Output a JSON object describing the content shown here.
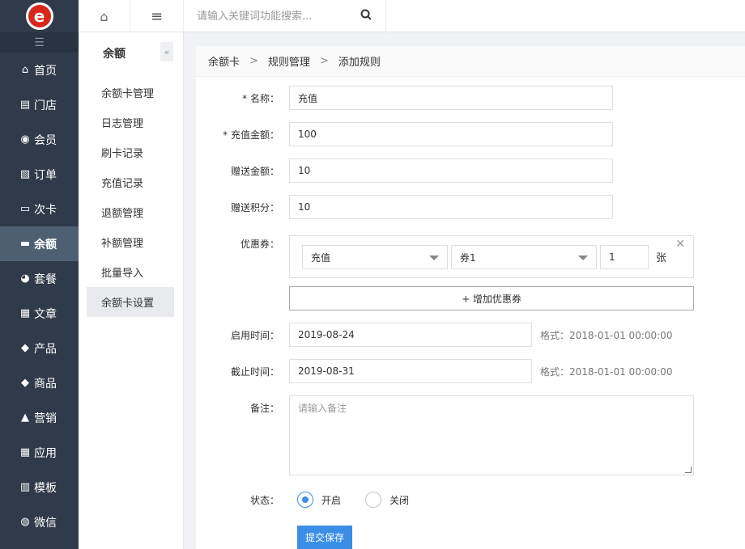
{
  "brand": {
    "logo_letter": "e"
  },
  "topbar": {
    "home_icon": "home-icon",
    "menu_icon": "hamburger-icon",
    "search_placeholder": "请输入关键词功能搜索...",
    "search_icon": "search-icon"
  },
  "leftnav": {
    "toggle_icon": "list-icon",
    "items": [
      {
        "label": "首页",
        "icon": "⌂"
      },
      {
        "label": "门店",
        "icon": "▤"
      },
      {
        "label": "会员",
        "icon": "◉"
      },
      {
        "label": "订单",
        "icon": "▧"
      },
      {
        "label": "次卡",
        "icon": "▭"
      },
      {
        "label": "余额",
        "icon": "▬"
      },
      {
        "label": "套餐",
        "icon": "◕"
      },
      {
        "label": "文章",
        "icon": "▦"
      },
      {
        "label": "产品",
        "icon": "◆"
      },
      {
        "label": "商品",
        "icon": "◆"
      },
      {
        "label": "营销",
        "icon": "▲"
      },
      {
        "label": "应用",
        "icon": "▦"
      },
      {
        "label": "模板",
        "icon": "▥"
      },
      {
        "label": "微信",
        "icon": "◍"
      }
    ]
  },
  "subnav": {
    "title": "余额",
    "collapse_icon": "«",
    "items": [
      "余额卡管理",
      "日志管理",
      "刷卡记录",
      "充值记录",
      "退额管理",
      "补额管理",
      "批量导入",
      "余额卡设置"
    ]
  },
  "breadcrumb": [
    "余额卡",
    "规则管理",
    "添加规则"
  ],
  "breadcrumb_sep": ">",
  "form": {
    "name": {
      "label": "* 名称：",
      "value": "充值"
    },
    "amount": {
      "label": "* 充值金额：",
      "value": "100"
    },
    "gift_amount": {
      "label": "赠送金额：",
      "value": "10"
    },
    "gift_points": {
      "label": "赠送积分：",
      "value": "10"
    },
    "coupon": {
      "label": "优惠券：",
      "type_value": "充值",
      "coupon_value": "券1",
      "qty": "1",
      "unit": "张",
      "close": "✕",
      "add_label": "+ 增加优惠券"
    },
    "start": {
      "label": "启用时间：",
      "value": "2019-08-24",
      "hint": "格式：2018-01-01 00:00:00"
    },
    "end": {
      "label": "截止时间：",
      "value": "2019-08-31",
      "hint": "格式：2018-01-01 00:00:00"
    },
    "remark": {
      "label": "备注：",
      "placeholder": "请输入备注"
    },
    "status": {
      "label": "状态：",
      "on": "开启",
      "off": "关闭"
    },
    "submit": "提交保存"
  },
  "colors": {
    "sidebar": "#2f3b4a",
    "active": "#4e5f72",
    "primary": "#3a8ee6",
    "logo": "#d9261c"
  }
}
